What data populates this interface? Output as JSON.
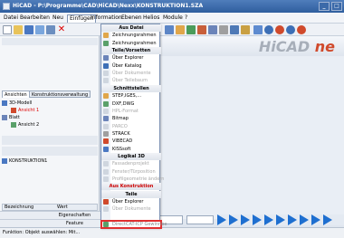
{
  "window": {
    "title": "HiCAD - P:\\Programme\\CAD\\HiCAD\\Nexx\\KONSTRUKTION1.SZA"
  },
  "menubar": {
    "items": [
      "Datei",
      "Bearbeiten",
      "Neu",
      "Einfügen",
      "Information",
      "Ebenen",
      "Helios",
      "Module",
      "?"
    ],
    "active": "Einfügen"
  },
  "logo": {
    "main": "HiCAD ",
    "accent": "ne",
    "accent_color": "#d04a2c"
  },
  "left_panel": {
    "tabs": [
      "Ansichten",
      "Konstruktionsverwaltung"
    ],
    "tree": [
      {
        "label": "3D-Modell",
        "color": "#000"
      },
      {
        "label": "Ansicht 1",
        "color": "#d00"
      },
      {
        "label": "Blatt",
        "color": "#000"
      },
      {
        "label": "Ansicht 2",
        "color": "#000"
      }
    ],
    "list_item": "KONSTRUKTION1",
    "prop_headers": [
      "Bezeichnung",
      "Wert"
    ],
    "bottom_tabs": [
      "Eigenschaften",
      "Feature"
    ]
  },
  "menu": {
    "items": [
      {
        "type": "section",
        "label": "Aus Datei"
      },
      {
        "type": "item",
        "label": "Zeichnungsrahmen",
        "enabled": true
      },
      {
        "type": "item",
        "label": "Zeichnungsrahmen",
        "enabled": true
      },
      {
        "type": "section",
        "label": "Teile/Vorsetten"
      },
      {
        "type": "item",
        "label": "Über Explorer",
        "enabled": true
      },
      {
        "type": "item",
        "label": "Über Katalog",
        "enabled": true
      },
      {
        "type": "item",
        "label": "Über Dokumente",
        "enabled": false
      },
      {
        "type": "item",
        "label": "Über Teilebaum",
        "enabled": false
      },
      {
        "type": "section",
        "label": "Schnittstellen"
      },
      {
        "type": "item",
        "label": "STEP,IGES,...",
        "enabled": true
      },
      {
        "type": "item",
        "label": "DXF,DWG",
        "enabled": true
      },
      {
        "type": "item",
        "label": "HPL-Format",
        "enabled": false
      },
      {
        "type": "item",
        "label": "Bitmap",
        "enabled": true
      },
      {
        "type": "item",
        "label": "PARCO",
        "enabled": false
      },
      {
        "type": "item",
        "label": "STRACK",
        "enabled": true
      },
      {
        "type": "item",
        "label": "VIBECAD",
        "enabled": true
      },
      {
        "type": "item",
        "label": "KISSsoft",
        "enabled": true
      },
      {
        "type": "section",
        "label": "Logikal 3D"
      },
      {
        "type": "item",
        "label": "Fassadenprojekt",
        "enabled": false
      },
      {
        "type": "item",
        "label": "Fenster/Türposition",
        "enabled": false
      },
      {
        "type": "item",
        "label": "Profilgeometrie ändern",
        "enabled": false
      },
      {
        "type": "section",
        "label": "Aus Konstruktion",
        "sub": true
      },
      {
        "type": "section",
        "label": "Teile"
      },
      {
        "type": "item",
        "label": "Über Explorer",
        "enabled": true
      },
      {
        "type": "item",
        "label": "Über Dokumente",
        "enabled": false
      },
      {
        "type": "spacer",
        "label": ""
      },
      {
        "type": "item",
        "label": "DirectCAT-ICP Gewinnbe",
        "enabled": true,
        "highlight": true
      }
    ]
  },
  "status": {
    "text": "Funktion: Objekt auswählen: Mit..."
  }
}
